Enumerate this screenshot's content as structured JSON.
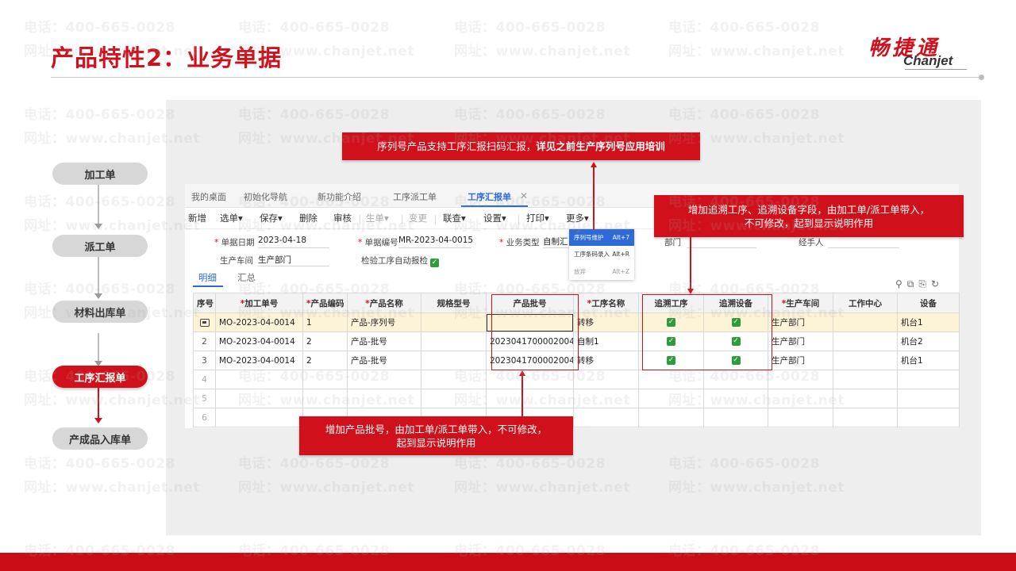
{
  "slide": {
    "title": "产品特性2：业务单据",
    "logo_cn": "畅捷通",
    "logo_en": "Chanjet"
  },
  "watermark": {
    "phone": "电话：400-665-0028",
    "site": "网址：www.chanjet.net"
  },
  "flow": {
    "steps": [
      "加工单",
      "派工单",
      "材料出库单",
      "工序汇报单",
      "产成品入库单"
    ],
    "active_index": 3
  },
  "app": {
    "tabs": [
      "我的桌面",
      "初始化导航",
      "新功能介绍",
      "工序派工单",
      "工序汇报单"
    ],
    "active_tab": "工序汇报单",
    "toolbar": [
      {
        "label": "新增"
      },
      {
        "label": "选单▾"
      },
      {
        "label": "保存▾"
      },
      {
        "label": "删除"
      },
      {
        "label": "审核"
      },
      {
        "label": "生单▾",
        "disabled": true
      },
      {
        "label": "变更",
        "disabled": true
      },
      {
        "label": "联查▾"
      },
      {
        "label": "设置▾"
      },
      {
        "label": "打印▾"
      },
      {
        "label": "更多▾"
      }
    ],
    "form": {
      "date_label": "单据日期",
      "date_value": "2023-04-18",
      "code_label": "单据编号",
      "code_value": "MR-2023-04-0015",
      "biz_type_label": "业务类型",
      "biz_type_value": "自制汇",
      "dept_label": "部门",
      "handler_label": "经手人",
      "workshop_label": "生产车间",
      "workshop_value": "生产部门",
      "auto_report_label": "检验工序自动报检"
    },
    "subtabs": [
      "明细",
      "汇总"
    ],
    "dropdown": [
      {
        "label": "序列号维护",
        "shortcut": "Alt+7",
        "highlight": true
      },
      {
        "label": "工序条码录入",
        "shortcut": "Alt+R"
      },
      {
        "label": "放弃",
        "shortcut": "Alt+Z",
        "disabled": true
      }
    ],
    "grid": {
      "columns": [
        "序号",
        "加工单号",
        "产品编码",
        "产品名称",
        "规格型号",
        "产品批号",
        "工序名称",
        "追溯工序",
        "追溯设备",
        "生产车间",
        "工作中心",
        "设备"
      ],
      "rows": [
        {
          "no": "",
          "order": "MO-2023-04-0014",
          "code": "1",
          "name": "产品-序列号",
          "spec": "",
          "batch": "",
          "process": "转移",
          "trace_proc": true,
          "trace_dev": true,
          "workshop": "生产部门",
          "center": "",
          "device": "机台1"
        },
        {
          "no": "2",
          "order": "MO-2023-04-0014",
          "code": "2",
          "name": "产品-批号",
          "spec": "",
          "batch": "2023041700002004",
          "process": "自制1",
          "trace_proc": true,
          "trace_dev": true,
          "workshop": "生产部门",
          "center": "",
          "device": "机台2"
        },
        {
          "no": "3",
          "order": "MO-2023-04-0014",
          "code": "2",
          "name": "产品-批号",
          "spec": "",
          "batch": "2023041700002004",
          "process": "转移",
          "trace_proc": true,
          "trace_dev": true,
          "workshop": "生产部门",
          "center": "",
          "device": "机台1"
        }
      ],
      "empty_rows": [
        "4",
        "5",
        "6"
      ]
    }
  },
  "callouts": {
    "top_plain": "序列号产品支持工序汇报扫码汇报，",
    "top_bold": "详见之前生产序列号应用培训",
    "right_line1": "增加追溯工序、追溯设备字段，由加工单/派工单带入，",
    "right_line2": "不可修改，起到显示说明作用",
    "bottom_line1": "增加产品批号，由加工单/派工单带入，不可修改，",
    "bottom_line2": "起到显示说明作用"
  },
  "colors": {
    "brand_red": "#d0101a",
    "accent_blue": "#2e6bd9",
    "check_green": "#2f9b3d"
  }
}
